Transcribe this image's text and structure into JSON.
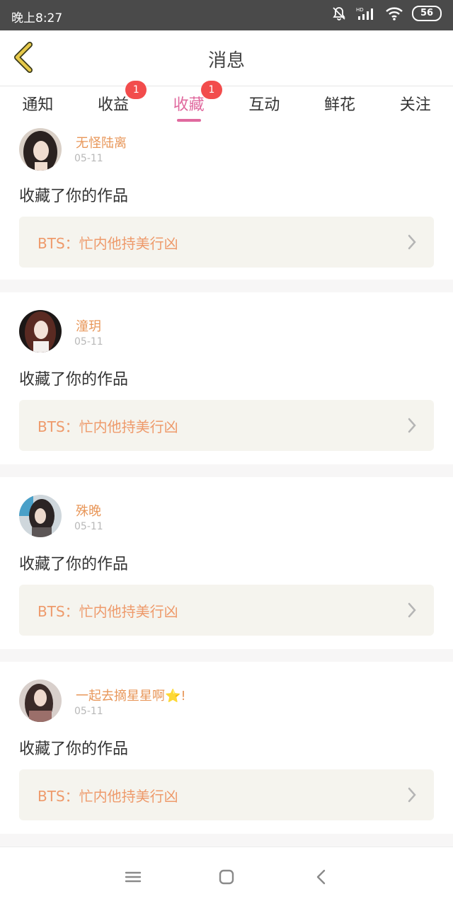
{
  "status_bar": {
    "time": "晚上8:27",
    "battery": "56",
    "icons": [
      "bell-off-icon",
      "hd-signal-icon",
      "wifi-icon",
      "battery-icon"
    ]
  },
  "header": {
    "title": "消息",
    "back_icon": "back-chevron-icon",
    "back_icon_color": "#e6c94a"
  },
  "tabs": [
    {
      "label": "通知",
      "active": false,
      "badge": ""
    },
    {
      "label": "收益",
      "active": false,
      "badge": "1"
    },
    {
      "label": "收藏",
      "active": true,
      "badge": "1"
    },
    {
      "label": "互动",
      "active": false,
      "badge": ""
    },
    {
      "label": "鲜花",
      "active": false,
      "badge": ""
    },
    {
      "label": "关注",
      "active": false,
      "badge": ""
    }
  ],
  "colors": {
    "accent": "#e0699e",
    "badge": "#f24c4c",
    "username": "#e8975a",
    "work_title": "#ee9a6b",
    "work_bg": "#f5f4ee"
  },
  "items": [
    {
      "user": "无怪陆离",
      "date": "05-11",
      "action": "收藏了你的作品",
      "work": "BTS：忙内他持美行凶"
    },
    {
      "user": "潼玥",
      "date": "05-11",
      "action": "收藏了你的作品",
      "work": "BTS：忙内他持美行凶"
    },
    {
      "user": "殊晚",
      "date": "05-11",
      "action": "收藏了你的作品",
      "work": "BTS：忙内他持美行凶"
    },
    {
      "user": "一起去摘星星啊⭐!",
      "date": "05-11",
      "action": "收藏了你的作品",
      "work": "BTS：忙内他持美行凶"
    }
  ],
  "nav": [
    "menu-icon",
    "home-icon",
    "back-icon"
  ]
}
